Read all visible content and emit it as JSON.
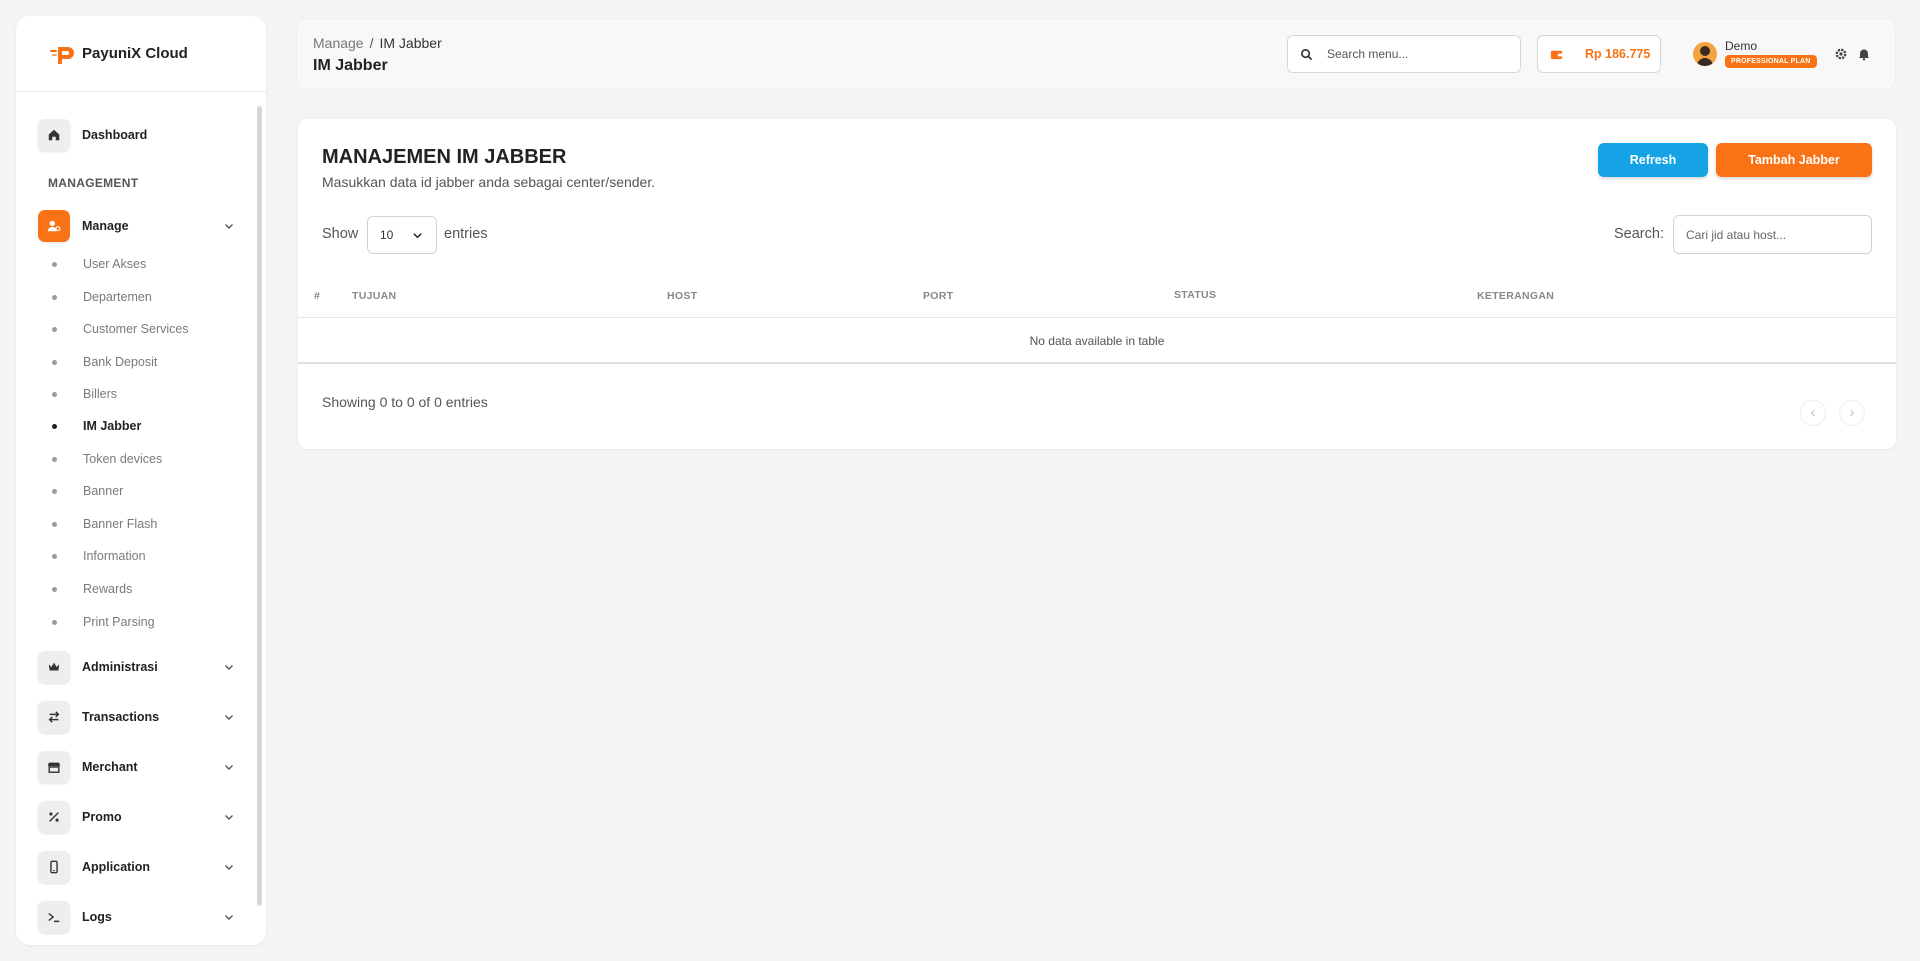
{
  "brand": {
    "name": "PayuniX Cloud",
    "accent": "#f97316"
  },
  "sidebar": {
    "dashboard": "Dashboard",
    "section": "MANAGEMENT",
    "manage": "Manage",
    "sub_items": [
      "User Akses",
      "Departemen",
      "Customer Services",
      "Bank Deposit",
      "Billers",
      "IM Jabber",
      "Token devices",
      "Banner",
      "Banner Flash",
      "Information",
      "Rewards",
      "Print Parsing"
    ],
    "active_sub": "IM Jabber",
    "groups": [
      "Administrasi",
      "Transactions",
      "Merchant",
      "Promo",
      "Application",
      "Logs"
    ]
  },
  "header": {
    "breadcrumb_parent": "Manage",
    "breadcrumb_sep": "/",
    "breadcrumb_current": "IM Jabber",
    "title": "IM Jabber",
    "search_placeholder": "Search menu...",
    "balance": "Rp 186.775",
    "user_name": "Demo",
    "plan": "PROFESSIONAL PLAN"
  },
  "card": {
    "title": "MANAJEMEN IM JABBER",
    "subtitle": "Masukkan data id jabber anda sebagai center/sender.",
    "refresh_label": "Refresh",
    "add_label": "Tambah Jabber",
    "show_label": "Show",
    "show_value": "10",
    "entries_label": "entries",
    "search_label": "Search:",
    "search_placeholder": "Cari jid atau host...",
    "columns": [
      "#",
      "TUJUAN",
      "HOST",
      "PORT",
      "STATUS",
      "KETERANGAN"
    ],
    "empty_text": "No data available in table",
    "info": "Showing 0 to 0 of 0 entries"
  }
}
